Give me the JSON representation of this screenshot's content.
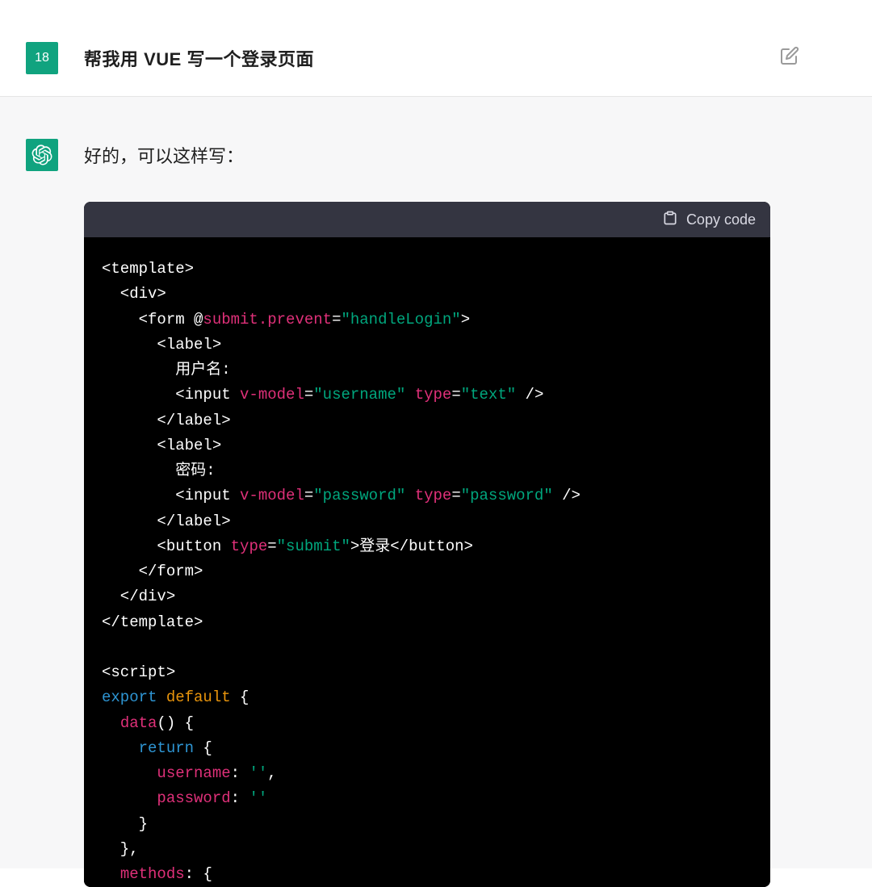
{
  "user": {
    "badge": "18",
    "prompt": "帮我用 VUE 写一个登录页面"
  },
  "assistant": {
    "intro": "好的，可以这样写：",
    "copy_label": "Copy code",
    "code": {
      "l01_a": "<template>",
      "l02_a": "  <div>",
      "l03_a": "    <form @",
      "l03_b": "submit.prevent",
      "l03_c": "=",
      "l03_d": "\"handleLogin\"",
      "l03_e": ">",
      "l04_a": "      <label>",
      "l05_a": "        用户名:",
      "l06_a": "        <input ",
      "l06_b": "v-model",
      "l06_c": "=",
      "l06_d": "\"username\"",
      "l06_e": " ",
      "l06_f": "type",
      "l06_g": "=",
      "l06_h": "\"text\"",
      "l06_i": " />",
      "l07_a": "      </label>",
      "l08_a": "      <label>",
      "l09_a": "        密码:",
      "l10_a": "        <input ",
      "l10_b": "v-model",
      "l10_c": "=",
      "l10_d": "\"password\"",
      "l10_e": " ",
      "l10_f": "type",
      "l10_g": "=",
      "l10_h": "\"password\"",
      "l10_i": " />",
      "l11_a": "      </label>",
      "l12_a": "      <button ",
      "l12_b": "type",
      "l12_c": "=",
      "l12_d": "\"submit\"",
      "l12_e": ">登录</button>",
      "l13_a": "    </form>",
      "l14_a": "  </div>",
      "l15_a": "</template>",
      "l16_a": "",
      "l17_a": "<script>",
      "l18_a": "export",
      "l18_b": " default",
      "l18_c": " {",
      "l19_a": "  ",
      "l19_b": "data",
      "l19_c": "() {",
      "l20_a": "    ",
      "l20_b": "return",
      "l20_c": " {",
      "l21_a": "      ",
      "l21_b": "username",
      "l21_c": ": ",
      "l21_d": "''",
      "l21_e": ",",
      "l22_a": "      ",
      "l22_b": "password",
      "l22_c": ": ",
      "l22_d": "''",
      "l23_a": "    }",
      "l24_a": "  },",
      "l25_a": "  ",
      "l25_b": "methods",
      "l25_c": ": {"
    }
  }
}
